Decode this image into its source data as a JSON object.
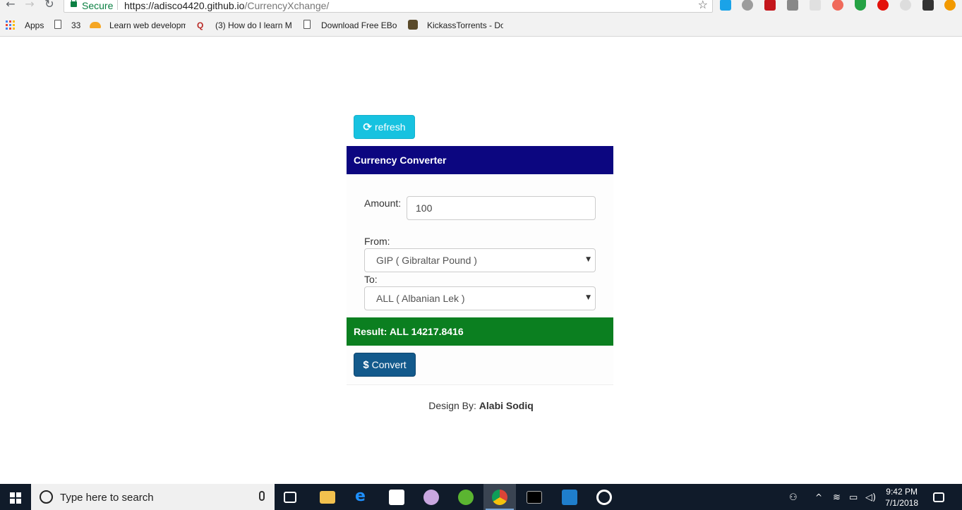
{
  "browser": {
    "secure_label": "Secure",
    "url_host": "https://adisco4420.github.io",
    "url_path": "/CurrencyXchange/",
    "bookmarks": [
      {
        "label": "Apps"
      },
      {
        "label": "33"
      },
      {
        "label": "Learn web developm"
      },
      {
        "label": "(3) How do I learn M"
      },
      {
        "label": "Download Free EBoo"
      },
      {
        "label": "KickassTorrents - Do"
      }
    ]
  },
  "app": {
    "refresh_label": "refresh",
    "title": "Currency Converter",
    "amount_label": "Amount:",
    "amount_value": "100",
    "from_label": "From:",
    "from_value": "GIP ( Gibraltar Pound )",
    "to_label": "To:",
    "to_value": "ALL ( Albanian Lek )",
    "result_text": "Result: ALL 14217.8416",
    "convert_label": "Convert",
    "footer_prefix": "Design By:",
    "footer_author": "Alabi Sodiq"
  },
  "taskbar": {
    "search_placeholder": "Type here to search",
    "time": "9:42 PM",
    "date": "7/1/2018"
  },
  "colors": {
    "refresh_button": "#17c2e0",
    "header": "#0c0680",
    "result": "#0b7f20",
    "convert_button": "#135a8c"
  }
}
